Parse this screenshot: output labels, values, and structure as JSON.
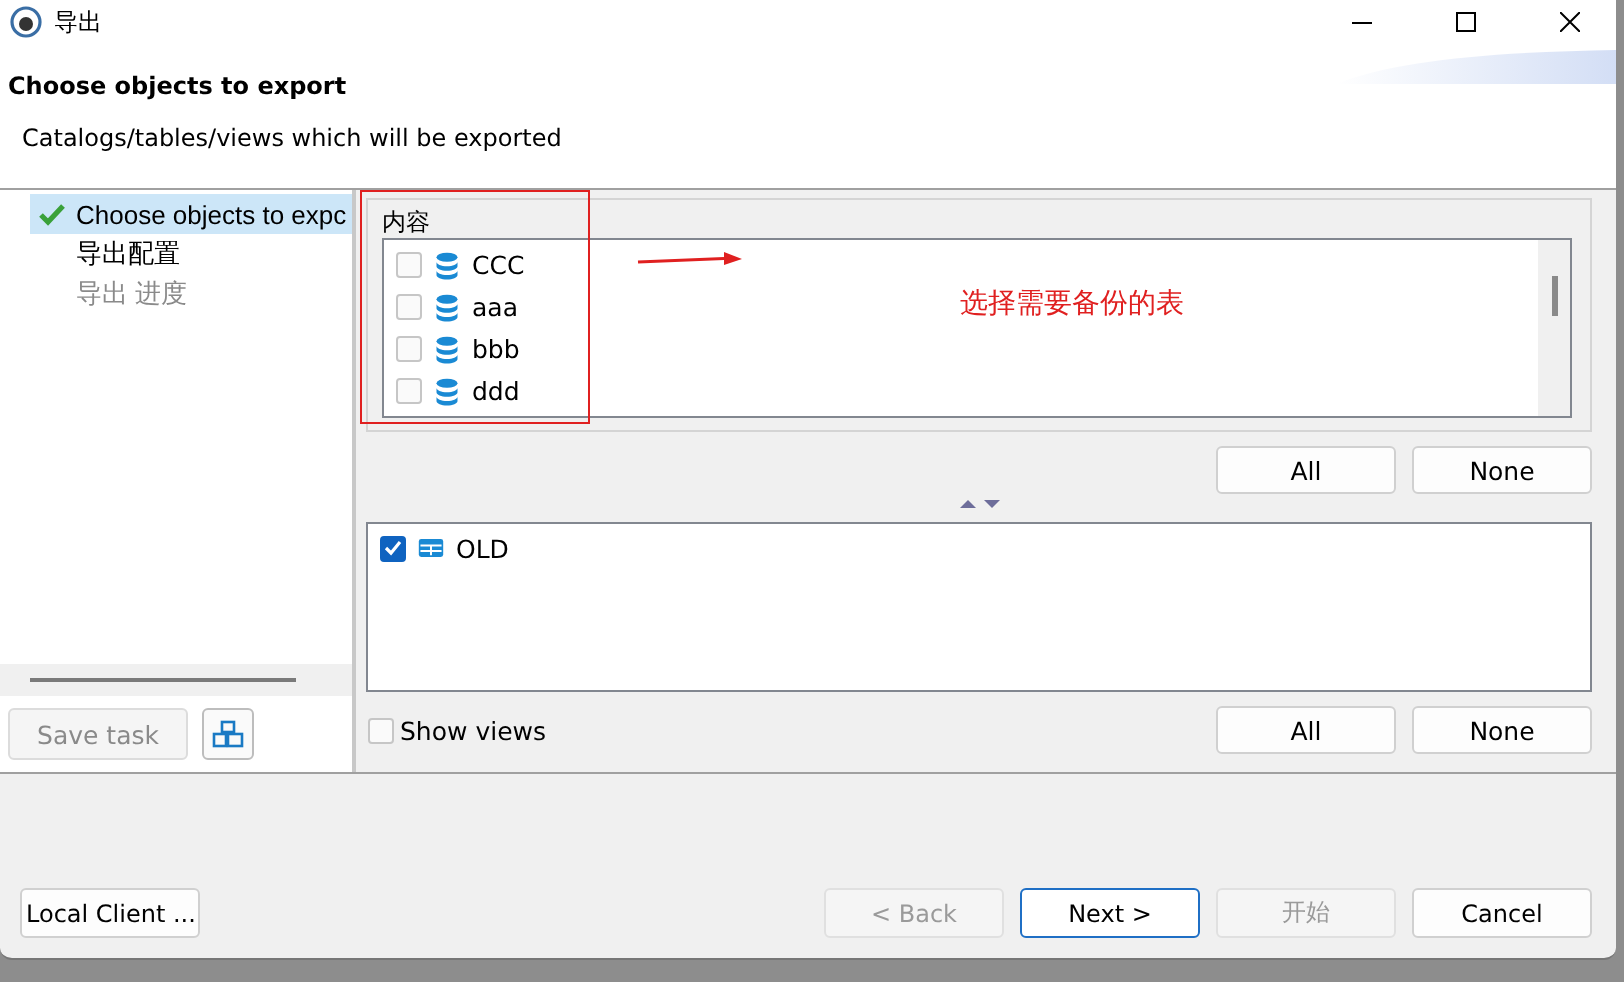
{
  "window": {
    "title": "导出"
  },
  "header": {
    "title": "Choose objects to export",
    "subtitle": "Catalogs/tables/views which will be exported"
  },
  "steps": [
    {
      "label": "Choose objects to expc",
      "selected": true,
      "done": true,
      "disabled": false
    },
    {
      "label": "导出配置",
      "selected": false,
      "done": false,
      "disabled": false
    },
    {
      "label": "导出 进度",
      "selected": false,
      "done": false,
      "disabled": true
    }
  ],
  "save_task": {
    "label": "Save task",
    "disabled": true
  },
  "catalogs": {
    "label": "内容",
    "items": [
      {
        "name": "CCC",
        "checked": false
      },
      {
        "name": "aaa",
        "checked": false
      },
      {
        "name": "bbb",
        "checked": false
      },
      {
        "name": "ddd",
        "checked": false
      }
    ],
    "buttons": [
      "All",
      "None"
    ]
  },
  "tables": {
    "items": [
      {
        "name": "OLD",
        "checked": true
      }
    ],
    "buttons": [
      "All",
      "None"
    ]
  },
  "show_views": {
    "label": "Show views",
    "checked": false
  },
  "local_client": {
    "label": "Local Client ..."
  },
  "footer_buttons": [
    {
      "label": "< Back",
      "disabled": true,
      "default": false
    },
    {
      "label": "Next >",
      "disabled": false,
      "default": true
    },
    {
      "label": "开始",
      "disabled": true,
      "default": false
    },
    {
      "label": "Cancel",
      "disabled": false,
      "default": false
    }
  ],
  "annotation": {
    "note": "选择需要备份的表"
  }
}
